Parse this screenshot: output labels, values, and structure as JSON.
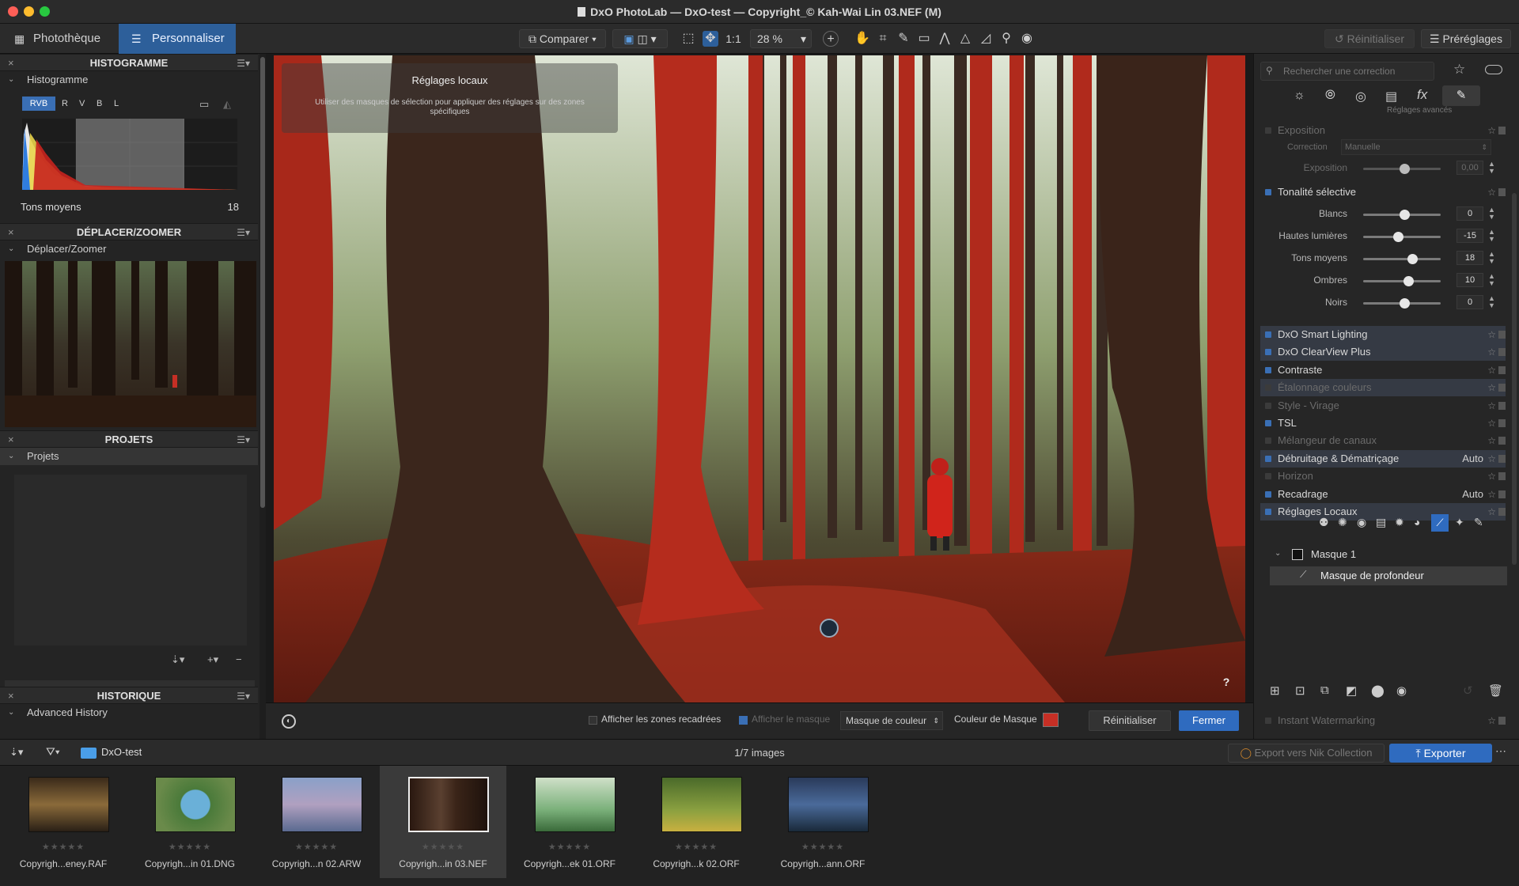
{
  "window": {
    "title": "DxO PhotoLab — DxO-test — Copyright_© Kah-Wai Lin 03.NEF (M)"
  },
  "toolbar": {
    "tab_library": "Photothèque",
    "tab_customize": "Personnaliser",
    "compare": "Comparer",
    "one_to_one": "1:1",
    "zoom": "28 %",
    "reset": "Réinitialiser",
    "presets": "Préréglages"
  },
  "left": {
    "histogram": {
      "header": "HISTOGRAMME",
      "sub": "Histogramme",
      "channels": [
        "RVB",
        "R",
        "V",
        "B",
        "L"
      ],
      "readout_label": "Tons moyens",
      "readout_value": "18"
    },
    "navigator": {
      "header": "DÉPLACER/ZOOMER",
      "sub": "Déplacer/Zoomer"
    },
    "projects": {
      "header": "PROJETS",
      "sub": "Projets"
    },
    "history": {
      "header": "HISTORIQUE",
      "sub": "Advanced History"
    }
  },
  "viewer": {
    "overlay_title": "Réglages locaux",
    "overlay_text": "Utiliser des masques de sélection pour appliquer des réglages sur des zones spécifiques",
    "help": "?"
  },
  "bottombar": {
    "show_cropped": "Afficher les zones recadrées",
    "show_mask": "Afficher le masque",
    "mask_mode": "Masque de couleur",
    "mask_color_label": "Couleur de Masque",
    "mask_color": "#c62f25",
    "reset": "Réinitialiser",
    "close": "Fermer"
  },
  "right": {
    "search_placeholder": "Rechercher une correction",
    "advanced_label": "Réglages avancés",
    "exposure": {
      "title": "Exposition",
      "correction_label": "Correction",
      "correction_value": "Manuelle",
      "exposure_label": "Exposition",
      "exposure_value": "0,00"
    },
    "tonality": {
      "title": "Tonalité sélective",
      "sliders": [
        {
          "label": "Blancs",
          "value": "0"
        },
        {
          "label": "Hautes lumières",
          "value": "-15"
        },
        {
          "label": "Tons moyens",
          "value": "18"
        },
        {
          "label": "Ombres",
          "value": "10"
        },
        {
          "label": "Noirs",
          "value": "0"
        }
      ]
    },
    "palettes": [
      {
        "label": "DxO Smart Lighting",
        "auto": ""
      },
      {
        "label": "DxO ClearView Plus",
        "auto": ""
      },
      {
        "label": "Contraste",
        "auto": ""
      },
      {
        "label": "Étalonnage couleurs",
        "auto": ""
      },
      {
        "label": "Style - Virage",
        "auto": ""
      },
      {
        "label": "TSL",
        "auto": ""
      },
      {
        "label": "Mélangeur de canaux",
        "auto": ""
      },
      {
        "label": "Débruitage & Dématriçage",
        "auto": "Auto"
      },
      {
        "label": "Horizon",
        "auto": ""
      },
      {
        "label": "Recadrage",
        "auto": "Auto"
      },
      {
        "label": "Réglages Locaux",
        "auto": ""
      }
    ],
    "masks": {
      "mask1": "Masque 1",
      "depth": "Masque de profondeur"
    },
    "watermark": "Instant Watermarking"
  },
  "filmstrip": {
    "folder": "DxO-test",
    "count": "1/7 images",
    "export_nik": "Export vers Nik Collection",
    "export": "Exporter",
    "items": [
      {
        "name": "Copyrigh...eney.RAF"
      },
      {
        "name": "Copyrigh...in 01.DNG"
      },
      {
        "name": "Copyrigh...n 02.ARW"
      },
      {
        "name": "Copyrigh...in 03.NEF"
      },
      {
        "name": "Copyrigh...ek 01.ORF"
      },
      {
        "name": "Copyrigh...k 02.ORF"
      },
      {
        "name": "Copyrigh...ann.ORF"
      }
    ]
  }
}
